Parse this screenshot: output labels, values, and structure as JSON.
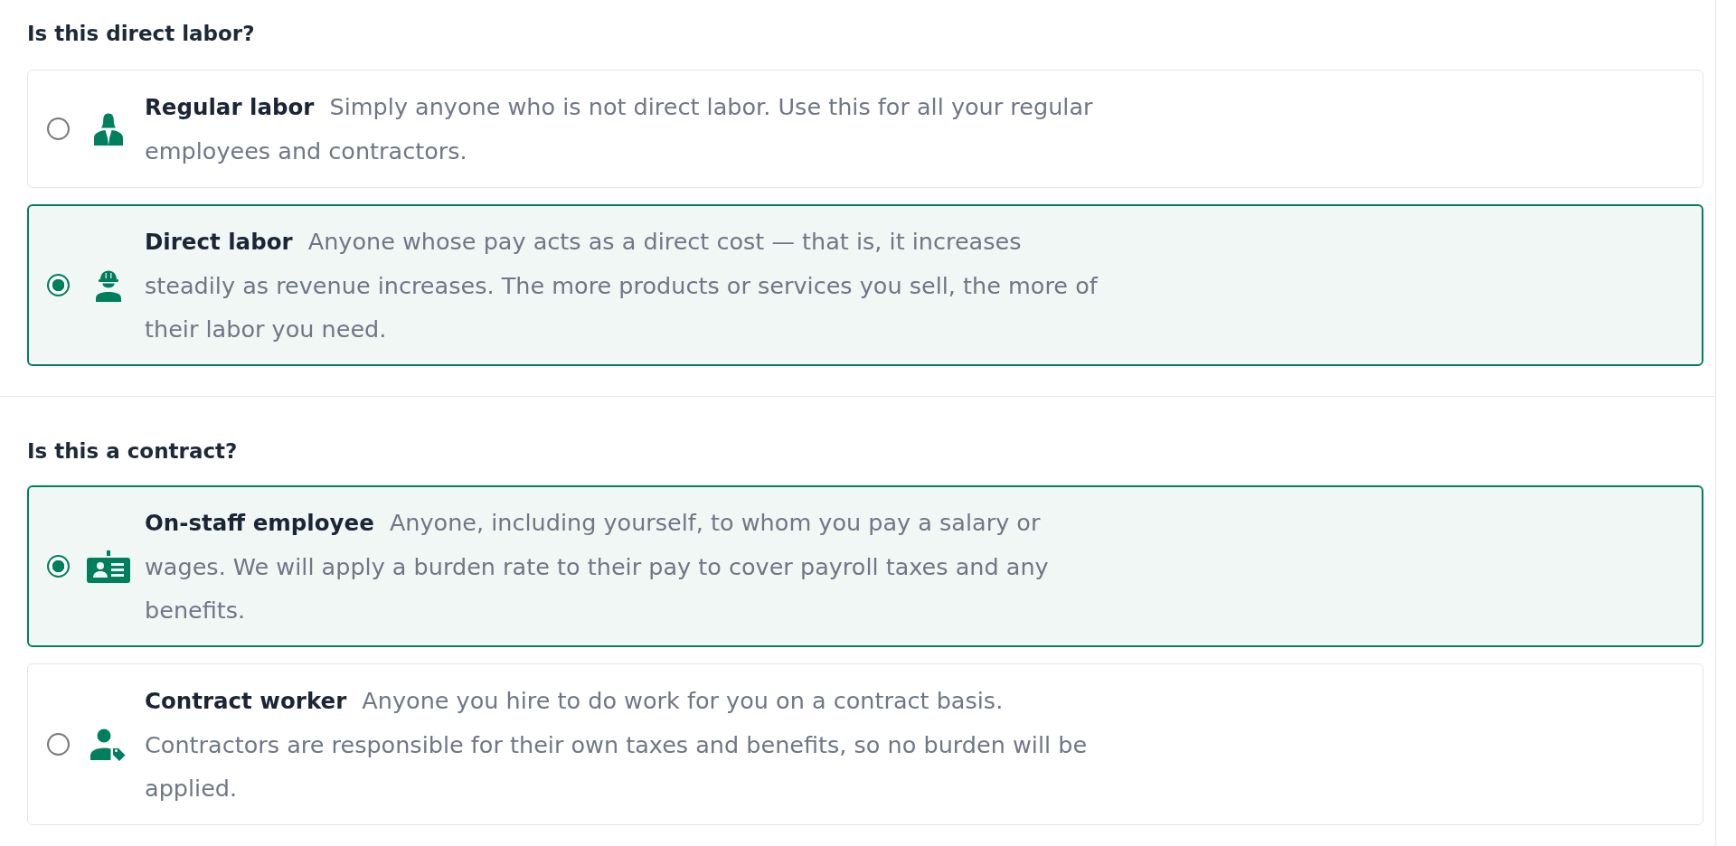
{
  "sections": [
    {
      "question": "Is this direct labor?",
      "options": [
        {
          "title": "Regular labor",
          "description": "Simply anyone who is not direct labor. Use this for all your regular employees and contractors.",
          "selected": false
        },
        {
          "title": "Direct labor",
          "description": "Anyone whose pay acts as a direct cost — that is, it increases steadily as revenue increases. The more products or services you sell, the more of their labor you need.",
          "selected": true
        }
      ]
    },
    {
      "question": "Is this a contract?",
      "options": [
        {
          "title": "On-staff employee",
          "description": "Anyone, including yourself, to whom you pay a salary or wages. We will apply a burden rate to their pay to cover payroll taxes and any benefits.",
          "selected": true
        },
        {
          "title": "Contract worker",
          "description": "Anyone you hire to do work for you on a contract basis. Contractors are responsible for their own taxes and benefits, so no burden will be applied.",
          "selected": false
        }
      ]
    }
  ]
}
